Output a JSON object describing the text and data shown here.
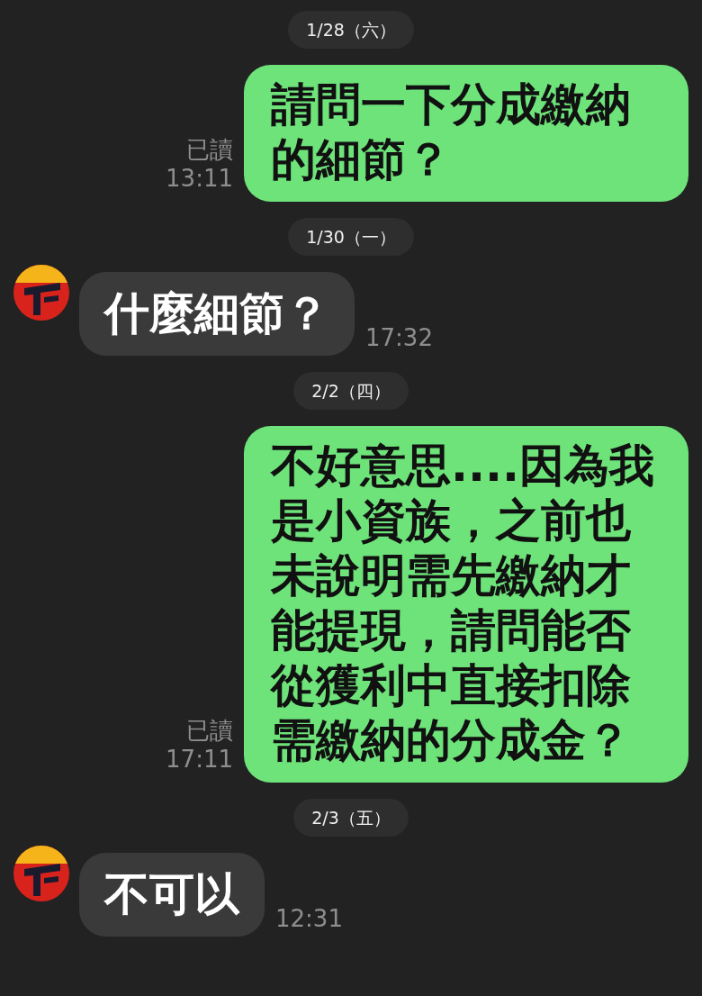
{
  "chat": [
    {
      "kind": "date",
      "text": "1/28（六）"
    },
    {
      "kind": "sent",
      "text": "請問一下分成繳納的細節？",
      "read": "已讀",
      "time": "13:11"
    },
    {
      "kind": "date",
      "text": "1/30（一）"
    },
    {
      "kind": "received",
      "text": "什麼細節？",
      "time": "17:32"
    },
    {
      "kind": "date",
      "text": "2/2（四）"
    },
    {
      "kind": "sent",
      "text": "不好意思....因為我是小資族，之前也未說明需先繳納才能提現，請問能否從獲利中直接扣除需繳納的分成金？",
      "read": "已讀",
      "time": "17:11"
    },
    {
      "kind": "date",
      "text": "2/3（五）"
    },
    {
      "kind": "received",
      "text": "不可以",
      "time": "12:31"
    }
  ]
}
